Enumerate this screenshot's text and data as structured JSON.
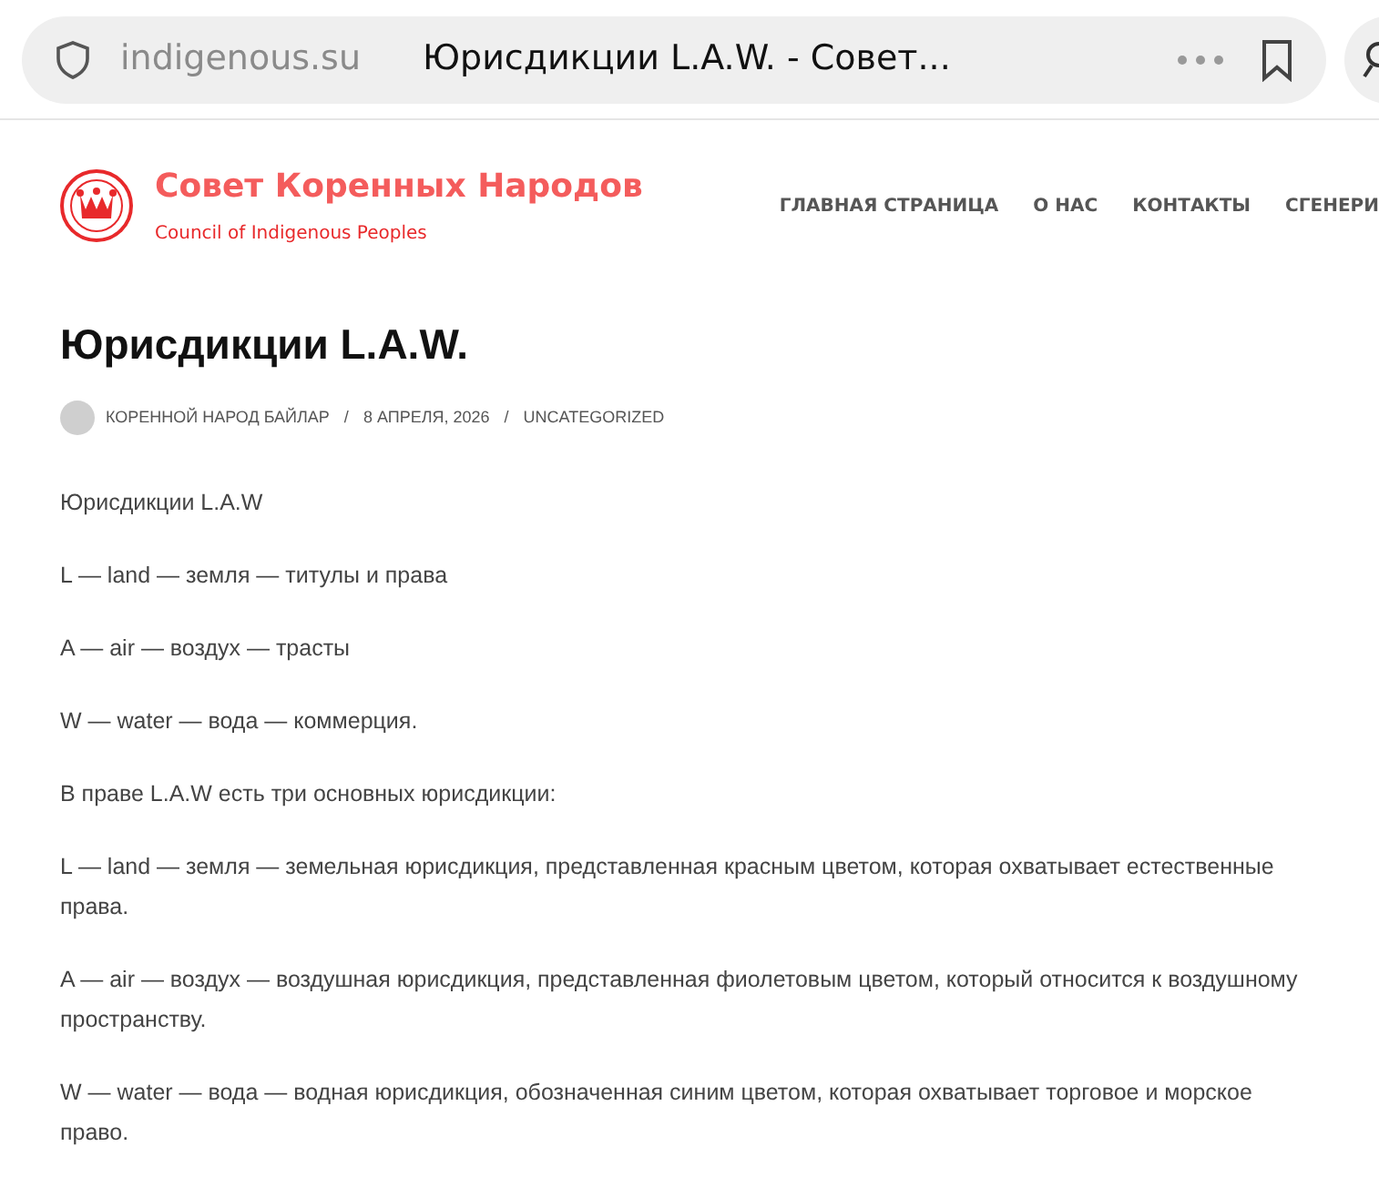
{
  "browser": {
    "domain": "indigenous.su",
    "tab_title": "Юрисдикции L.A.W. - Совет..."
  },
  "site": {
    "title": "Совет Коренных Народов",
    "tagline": "Council of Indigenous Peoples"
  },
  "nav": [
    "ГЛАВНАЯ СТРАНИЦА",
    "О НАС",
    "КОНТАКТЫ",
    "СГЕНЕРИ"
  ],
  "post": {
    "title": "Юрисдикции L.A.W.",
    "author": "КОРЕННОЙ НАРОД БАЙЛАР",
    "date": "8 АПРЕЛЯ, 2026",
    "category": "UNCATEGORIZED",
    "separators": [
      "/",
      "/"
    ],
    "paragraphs": [
      "Юрисдикции L.A.W",
      "L — land — земля — титулы и права",
      "A — air — воздух — трасты",
      "W — water — вода — коммерция.",
      "В праве L.A.W есть три основных юрисдикции:",
      "L — land — земля — земельная юрисдикция, представленная красным цветом, которая охватывает естественные права.",
      "A — air — воздух — воздушная юрисдикция, представленная фиолетовым цветом, который относится к воздушному пространству.",
      "W — water — вода — водная юрисдикция, обозначенная синим цветом, которая охватывает торговое и морское право."
    ]
  }
}
